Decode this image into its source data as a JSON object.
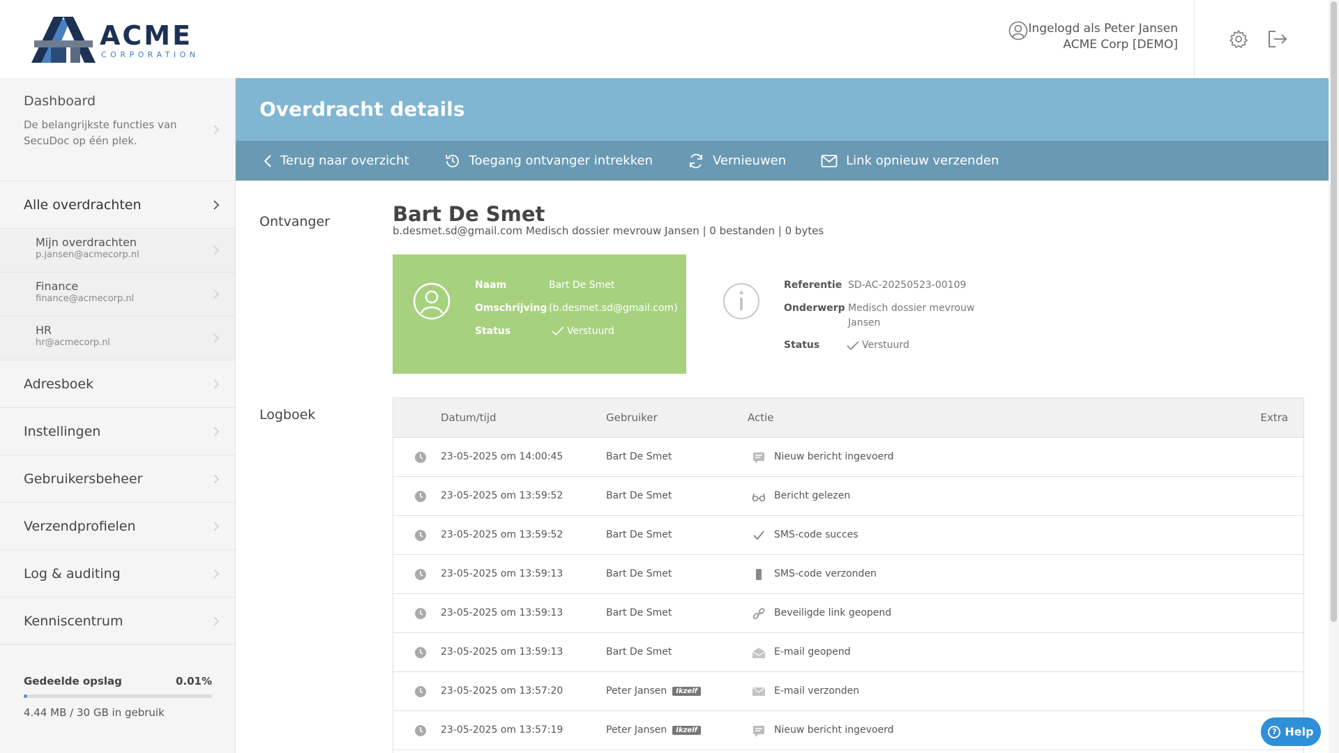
{
  "header": {
    "logo_name": "ACME",
    "logo_sub": "CORPORATION",
    "user_line": "Ingelogd als Peter Jansen",
    "org_line": "ACME Corp [DEMO]",
    "icons": [
      "user-circle-icon",
      "gear-icon",
      "logout-icon"
    ]
  },
  "sidebar": {
    "dashboard": {
      "title": "Dashboard",
      "description": "De belangrijkste functies van SecuDoc op één plek."
    },
    "all_transfers": "Alle overdrachten",
    "sub_items": [
      {
        "title": "Mijn overdrachten",
        "email": "p.jansen@acmecorp.nl"
      },
      {
        "title": "Finance",
        "email": "finance@acmecorp.nl"
      },
      {
        "title": "HR",
        "email": "hr@acmecorp.nl"
      }
    ],
    "main_items": [
      "Adresboek",
      "Instellingen",
      "Gebruikersbeheer",
      "Verzendprofielen",
      "Log & auditing",
      "Kenniscentrum"
    ],
    "storage": {
      "label": "Gedeelde opslag",
      "percent_label": "0.01%",
      "fraction": 0.0001,
      "usage": "4.44 MB / 30 GB in gebruik"
    }
  },
  "page": {
    "title": "Overdracht details",
    "toolbar": {
      "back": "Terug naar overzicht",
      "revoke": "Toegang ontvanger intrekken",
      "renew": "Vernieuwen",
      "resend": "Link opnieuw verzenden"
    }
  },
  "recipient": {
    "section_label": "Ontvanger",
    "name": "Bart De Smet",
    "meta": "b.desmet.sd@gmail.com Medisch dossier mevrouw Jansen | 0 bestanden | 0 bytes",
    "card": {
      "name_label": "Naam",
      "name_value": "Bart De Smet",
      "desc_label": "Omschrijving",
      "desc_value": "(b.desmet.sd@gmail.com)",
      "status_label": "Status",
      "status_value": "Verstuurd",
      "color": "#a7d17f"
    },
    "info": {
      "ref_label": "Referentie",
      "ref_value": "SD-AC-20250523-00109",
      "subject_label": "Onderwerp",
      "subject_value_1": "Medisch dossier mevrouw",
      "subject_value_2": "Jansen",
      "status_label": "Status",
      "status_value": "Verstuurd"
    }
  },
  "log": {
    "section_label": "Logboek",
    "columns": {
      "datetime": "Datum/tijd",
      "user": "Gebruiker",
      "action": "Actie",
      "extra": "Extra"
    },
    "self_badge": "Ikzelf",
    "rows": [
      {
        "datetime": "23-05-2025 om 14:00:45",
        "user": "Bart De Smet",
        "self": false,
        "icon": "message-icon",
        "action": "Nieuw bericht ingevoerd"
      },
      {
        "datetime": "23-05-2025 om 13:59:52",
        "user": "Bart De Smet",
        "self": false,
        "icon": "glasses-icon",
        "action": "Bericht gelezen"
      },
      {
        "datetime": "23-05-2025 om 13:59:52",
        "user": "Bart De Smet",
        "self": false,
        "icon": "check-icon",
        "action": "SMS-code succes"
      },
      {
        "datetime": "23-05-2025 om 13:59:13",
        "user": "Bart De Smet",
        "self": false,
        "icon": "phone-icon",
        "action": "SMS-code verzonden"
      },
      {
        "datetime": "23-05-2025 om 13:59:13",
        "user": "Bart De Smet",
        "self": false,
        "icon": "link-icon",
        "action": "Beveiligde link geopend"
      },
      {
        "datetime": "23-05-2025 om 13:59:13",
        "user": "Bart De Smet",
        "self": false,
        "icon": "envelope-open-icon",
        "action": "E-mail geopend"
      },
      {
        "datetime": "23-05-2025 om 13:57:20",
        "user": "Peter Jansen",
        "self": true,
        "icon": "envelope-icon",
        "action": "E-mail verzonden"
      },
      {
        "datetime": "23-05-2025 om 13:57:19",
        "user": "Peter Jansen",
        "self": true,
        "icon": "message-icon",
        "action": "Nieuw bericht ingevoerd"
      }
    ]
  },
  "help": {
    "label": "Help"
  }
}
